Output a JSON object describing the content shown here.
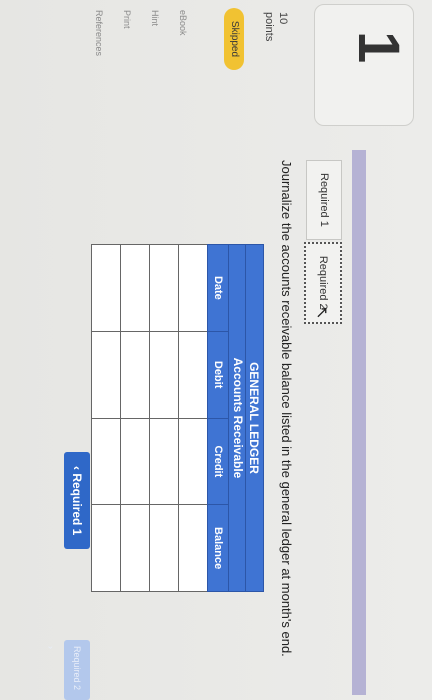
{
  "question": {
    "number": "1",
    "points_value": "10",
    "points_label": "points",
    "status": "Skipped"
  },
  "side_links": [
    "eBook",
    "Hint",
    "Print",
    "References"
  ],
  "tabs": [
    "Required 1",
    "Required 2"
  ],
  "instruction": "Journalize the accounts receivable balance listed in the general ledger at month's end.",
  "ledger": {
    "title": "GENERAL LEDGER",
    "subtitle": "Accounts Receivable",
    "columns": [
      "Date",
      "Debit",
      "Credit",
      "Balance"
    ],
    "row_count": 4
  },
  "nav": {
    "prev_label": "Required 1",
    "next_label": "Required 2"
  }
}
